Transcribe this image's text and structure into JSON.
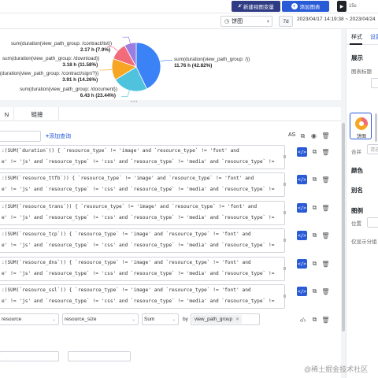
{
  "topbar": {
    "new_var_label": "新建视图变量",
    "add_chart_label": "添加图表",
    "refresh_label": "15s"
  },
  "subbar": {
    "chart_type": "饼图",
    "range_shortcut": "7d",
    "time_range": "2023/04/17 14:19:38 ~ 2023/04/24"
  },
  "chart_data": {
    "type": "pie",
    "slices": [
      {
        "label": "sum(duration{view_path_group: /})",
        "value": 11.76,
        "unit": "h",
        "percent": 42.82,
        "value_text": "11.76 h (42.82%)",
        "color": "#3b82f6"
      },
      {
        "label": "sum(duration{view_path_group: /document})",
        "value": 6.43,
        "unit": "h",
        "percent": 23.44,
        "value_text": "6.43 h (23.44%)",
        "color": "#4fc3dd"
      },
      {
        "label": "sum(duration{view_path_group: /contract/sign/?})",
        "value": 3.91,
        "unit": "h",
        "percent": 14.26,
        "value_text": "3.91 h (14.26%)",
        "color": "#f6a623"
      },
      {
        "label": "sum(duration{view_path_group: /download})",
        "value": 3.18,
        "unit": "h",
        "percent": 11.58,
        "value_text": "3.18 h (11.58%)",
        "color": "#f26b7a"
      },
      {
        "label": "sum(duration{view_path_group: /contract/list})",
        "value": 2.17,
        "unit": "h",
        "percent": 7.9,
        "value_text": "2.17 h (7.9%)",
        "color": "#9b7fe0"
      }
    ]
  },
  "tabs": [
    {
      "label": "N"
    },
    {
      "label": "链接"
    }
  ],
  "editor": {
    "add_query_label": "添加查询",
    "as_label": "AS",
    "queries": [
      {
        "line1": ":(SUM(`duration`)) { `resource_type` != 'image' and `resource_type` != 'font' and",
        "line2": "e' != 'js' and `resource_type` != 'css' and `resource_type` != 'media' and `resource_type` !="
      },
      {
        "line1": ":(SUM(`resource_ttfb`)) { `resource_type` != 'image' and `resource_type` != 'font' and",
        "line2": "e' != 'js' and `resource_type` != 'css' and `resource_type` != 'media' and `resource_type` !="
      },
      {
        "line1": ":(SUM(`resource_trans`)) { `resource_type` != 'image' and `resource_type` != 'font' and",
        "line2": "e' != 'js' and `resource_type` != 'css' and `resource_type` != 'media' and `resource_type` !="
      },
      {
        "line1": ":(SUM(`resource_tcp`)) { `resource_type` != 'image' and `resource_type` != 'font' and",
        "line2": "e' != 'js' and `resource_type` != 'css' and `resource_type` != 'media' and `resource_type` !="
      },
      {
        "line1": ":(SUM(`resource_dns`)) { `resource_type` != 'image' and `resource_type` != 'font' and",
        "line2": "e' != 'js' and `resource_type` != 'css' and `resource_type` != 'media' and `resource_type` !="
      },
      {
        "line1": ":(SUM(`resource_ssl`)) { `resource_type` != 'image' and `resource_type` != 'font' and",
        "line2": "e' != 'js' and `resource_type` != 'css' and `resource_type` != 'media' and `resource_type` !="
      }
    ],
    "builder": {
      "source": "resource",
      "field": "resource_size",
      "func": "Sum",
      "by_label": "by",
      "group_by": "view_path_group"
    }
  },
  "right_panel": {
    "tab_style": "样式",
    "tab_settings": "设置",
    "display_title": "展示",
    "chart_title_label": "图表标题",
    "pie_caption": "饼图",
    "merge_label": "合并",
    "merge_placeholder": "请选",
    "color_title": "颜色",
    "alias_title": "别名",
    "legend_title": "图例",
    "position_label": "位置",
    "group_label": "仅显示分组"
  },
  "watermark": "@稀土掘金技术社区"
}
